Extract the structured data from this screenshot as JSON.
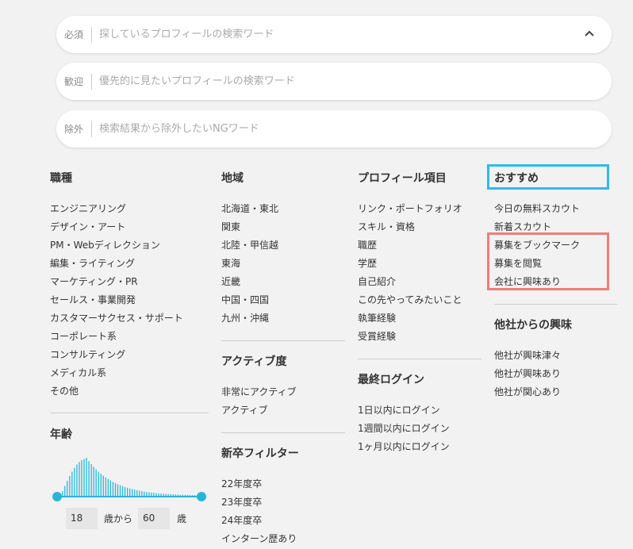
{
  "search": {
    "required": {
      "tag": "必須",
      "placeholder": "探しているプロフィールの検索ワード"
    },
    "welcome": {
      "tag": "歓迎",
      "placeholder": "優先的に見たいプロフィールの検索ワード"
    },
    "exclude": {
      "tag": "除外",
      "placeholder": "検索結果から除外したいNGワード"
    }
  },
  "job": {
    "title": "職種",
    "items": [
      "エンジニアリング",
      "デザイン・アート",
      "PM・Webディレクション",
      "編集・ライティング",
      "マーケティング・PR",
      "セールス・事業開発",
      "カスタマーサクセス・サポート",
      "コーポレート系",
      "コンサルティング",
      "メディカル系",
      "その他"
    ]
  },
  "age": {
    "title": "年齢",
    "min": "18",
    "max": "60",
    "from_label": "歳から",
    "unit": "歳",
    "accent": "#29b6d6"
  },
  "region": {
    "title": "地域",
    "items": [
      "北海道・東北",
      "関東",
      "北陸・甲信越",
      "東海",
      "近畿",
      "中国・四国",
      "九州・沖縄"
    ]
  },
  "activity": {
    "title": "アクティブ度",
    "items": [
      "非常にアクティブ",
      "アクティブ"
    ]
  },
  "graduate": {
    "title": "新卒フィルター",
    "items": [
      "22年度卒",
      "23年度卒",
      "24年度卒",
      "インターン歴あり"
    ]
  },
  "profile": {
    "title": "プロフィール項目",
    "items": [
      "リンク・ポートフォリオ",
      "スキル・資格",
      "職歴",
      "学歴",
      "自己紹介",
      "この先やってみたいこと",
      "執筆経験",
      "受賞経験"
    ]
  },
  "login": {
    "title": "最終ログイン",
    "items": [
      "1日以内にログイン",
      "1週間以内にログイン",
      "1ヶ月以内にログイン"
    ]
  },
  "recommend": {
    "title": "おすすめ",
    "items": [
      "今日の無料スカウト",
      "新着スカウト",
      "募集をブックマーク",
      "募集を閲覧",
      "会社に興味あり"
    ]
  },
  "interest": {
    "title": "他社からの興味",
    "items": [
      "他社が興味津々",
      "他社が興味あり",
      "他社が関心あり"
    ]
  },
  "icons": {
    "chevron": "chevron-up-icon"
  },
  "colors": {
    "highlight_blue": "#2ebbe8",
    "highlight_red": "#f07c7c"
  }
}
